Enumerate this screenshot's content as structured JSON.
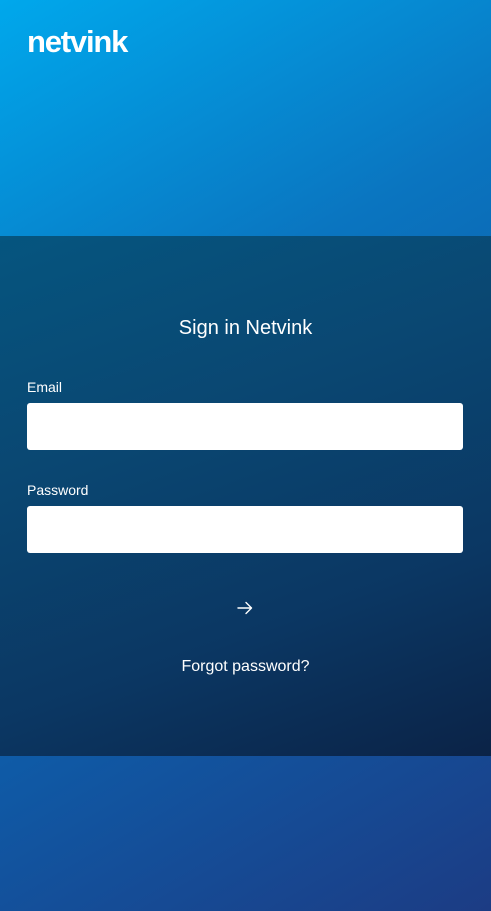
{
  "brand": {
    "logo_text": "netvink"
  },
  "login": {
    "title": "Sign in Netvink",
    "email_label": "Email",
    "email_value": "",
    "email_placeholder": "",
    "password_label": "Password",
    "password_value": "",
    "password_placeholder": "",
    "submit_icon": "arrow-right-icon",
    "forgot_link": "Forgot password?"
  },
  "colors": {
    "background_top": "#00a8ec",
    "background_bottom": "#1c3c84",
    "panel_start": "#05557f",
    "panel_end": "#0b2347",
    "text": "#ffffff",
    "input_background": "#ffffff"
  }
}
